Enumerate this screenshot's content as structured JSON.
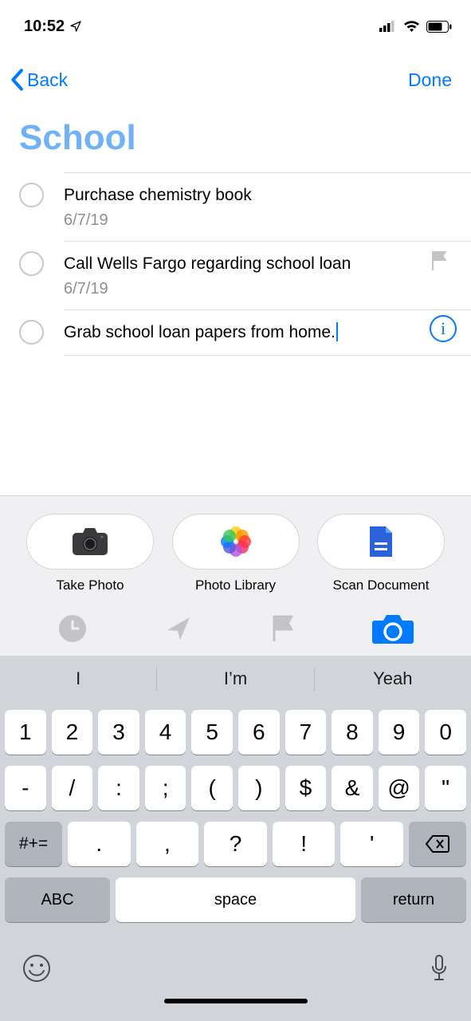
{
  "statusbar": {
    "time": "10:52"
  },
  "nav": {
    "back": "Back",
    "done": "Done"
  },
  "list": {
    "title": "School",
    "items": [
      {
        "title": "Purchase chemistry book",
        "date": "6/7/19",
        "flag": false,
        "editing": false
      },
      {
        "title": "Call Wells Fargo regarding school loan",
        "date": "6/7/19",
        "flag": true,
        "editing": false
      },
      {
        "title": "Grab school loan papers from home.",
        "date": "",
        "flag": false,
        "editing": true
      }
    ]
  },
  "attachments": {
    "take_photo": "Take Photo",
    "photo_library": "Photo Library",
    "scan_document": "Scan Document"
  },
  "suggestions": [
    "I",
    "I’m",
    "Yeah"
  ],
  "keyboard": {
    "row1": [
      "1",
      "2",
      "3",
      "4",
      "5",
      "6",
      "7",
      "8",
      "9",
      "0"
    ],
    "row2": [
      "-",
      "/",
      ":",
      ";",
      "(",
      ")",
      "$",
      "&",
      "@",
      "\""
    ],
    "row3_shift": "#+=",
    "row3": [
      ".",
      ",",
      "?",
      "!",
      "'"
    ],
    "row4_abc": "ABC",
    "row4_space": "space",
    "row4_return": "return"
  }
}
